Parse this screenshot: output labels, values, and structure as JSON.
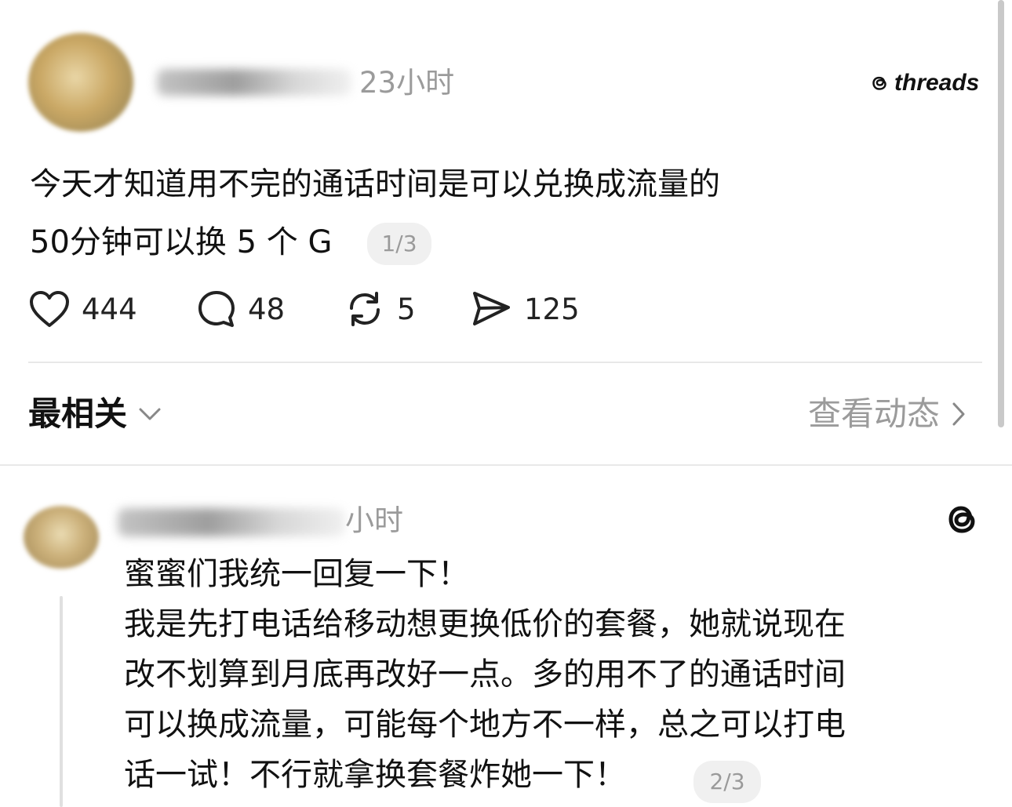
{
  "post": {
    "time": "23小时",
    "brand": "threads",
    "lines": [
      "今天才知道用不完的通话时间是可以兑换成流量的",
      "50分钟可以换 5 个 G"
    ],
    "page_indicator": "1/3",
    "likes": "444",
    "comments": "48",
    "reposts": "5",
    "shares": "125"
  },
  "sort_bar": {
    "sort_label": "最相关",
    "activity_label": "查看动态"
  },
  "reply": {
    "time": "小时",
    "lines": [
      "蜜蜜们我统一回复一下！",
      "我是先打电话给移动想更换低价的套餐，她就说现在",
      "改不划算到月底再改好一点。多的用不了的通话时间",
      "可以换成流量，可能每个地方不一样，总之可以打电",
      "话一试！不行就拿换套餐炸她一下！"
    ],
    "page_indicator": "2/3"
  },
  "icons": {
    "like": "heart-icon",
    "comment": "speech-bubble-icon",
    "repost": "repost-arrows-icon",
    "share": "send-icon",
    "sort": "chevron-down-icon",
    "activity": "chevron-right-icon",
    "brand": "threads-logo-icon"
  }
}
